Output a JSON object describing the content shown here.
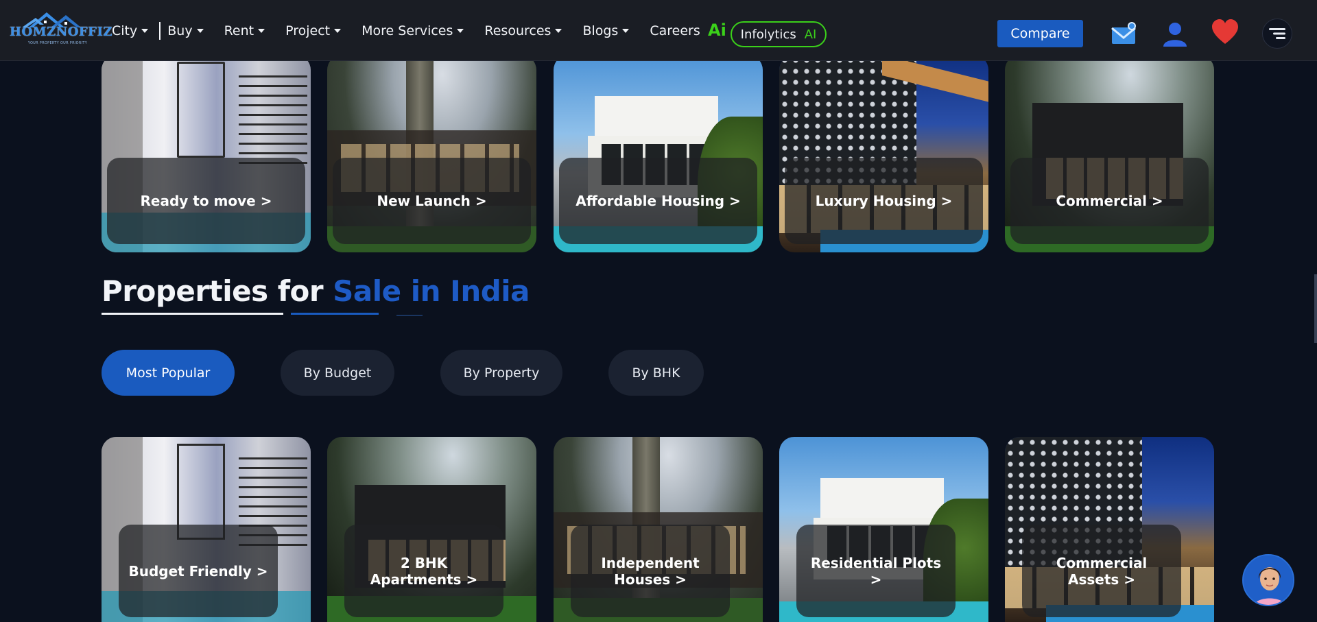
{
  "brand": {
    "name": "HomzNOffiz",
    "tagline": "YOUR PROPERTY OUR PRIORITY"
  },
  "nav": {
    "items": [
      {
        "label": "City",
        "dropdown": true
      },
      {
        "label": "Buy",
        "dropdown": true
      },
      {
        "label": "Rent",
        "dropdown": true
      },
      {
        "label": "Project",
        "dropdown": true
      },
      {
        "label": "More Services",
        "dropdown": true
      },
      {
        "label": "Resources",
        "dropdown": true
      },
      {
        "label": "Blogs",
        "dropdown": true
      },
      {
        "label": "Careers",
        "dropdown": false
      }
    ],
    "ai_badge": "Ai",
    "infolytics": {
      "label": "Infolytics",
      "ai": "AI"
    },
    "compare_label": "Compare",
    "icons": [
      "mail-icon",
      "user-icon",
      "heart-icon",
      "menu-icon"
    ]
  },
  "categories": [
    {
      "label": "Ready to move >"
    },
    {
      "label": "New Launch >"
    },
    {
      "label": "Affordable Housing >"
    },
    {
      "label": "Luxury Housing >"
    },
    {
      "label": "Commercial >"
    }
  ],
  "section": {
    "title_white": "Properties for",
    "title_blue": "Sale in India"
  },
  "filters": [
    {
      "label": "Most Popular",
      "active": true
    },
    {
      "label": "By Budget",
      "active": false
    },
    {
      "label": "By Property",
      "active": false
    },
    {
      "label": "By BHK",
      "active": false
    }
  ],
  "listings": [
    {
      "label": "Budget Friendly >"
    },
    {
      "label": "2 BHK Apartments >"
    },
    {
      "label": "Independent Houses >"
    },
    {
      "label": "Residential Plots >"
    },
    {
      "label": "Commercial Assets >"
    }
  ],
  "colors": {
    "accent": "#1a5bbf",
    "ai_green": "#3bd11a",
    "background": "#0b111e",
    "navbar": "#1a1d24"
  }
}
